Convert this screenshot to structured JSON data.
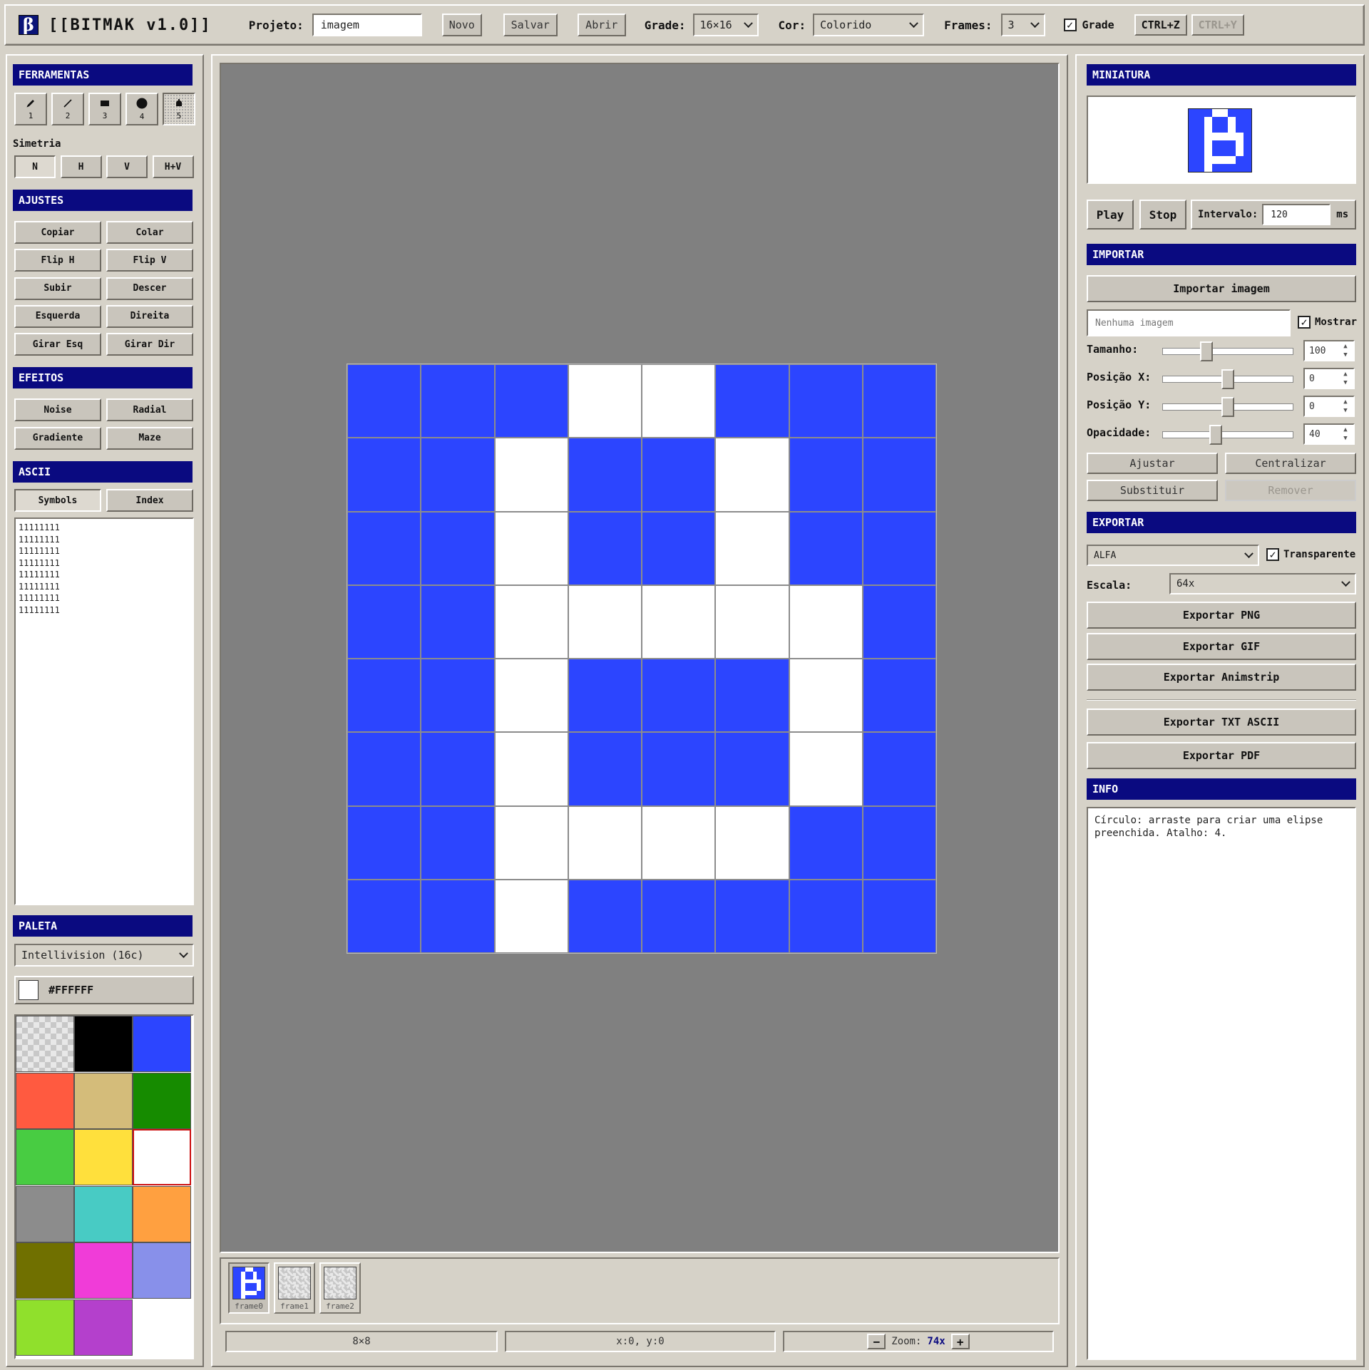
{
  "app": {
    "logo_glyph": "β",
    "title": "[[BITMAK v1.0]]"
  },
  "toolbar": {
    "project_label": "Projeto:",
    "project_value": "imagem",
    "new_label": "Novo",
    "save_label": "Salvar",
    "open_label": "Abrir",
    "grid_label": "Grade:",
    "grid_value": "16×16",
    "color_label": "Cor:",
    "color_value": "Colorido",
    "frames_label": "Frames:",
    "frames_value": "3",
    "show_grid_label": "Grade",
    "show_grid_checked": true,
    "undo_label": "CTRL+Z",
    "redo_label": "CTRL+Y"
  },
  "left": {
    "tools_title": "FERRAMENTAS",
    "tools": [
      {
        "icon": "pencil-icon",
        "key": "1"
      },
      {
        "icon": "line-icon",
        "key": "2"
      },
      {
        "icon": "rectangle-icon",
        "key": "3"
      },
      {
        "icon": "circle-icon",
        "key": "4"
      },
      {
        "icon": "bucket-fill-icon",
        "key": "5"
      }
    ],
    "active_tool_index": 4,
    "symmetry_label": "Simetria",
    "symmetry": [
      "N",
      "H",
      "V",
      "H+V"
    ],
    "symmetry_active": "N",
    "adjust_title": "AJUSTES",
    "adjust_buttons": [
      "Copiar",
      "Colar",
      "Flip H",
      "Flip V",
      "Subir",
      "Descer",
      "Esquerda",
      "Direita",
      "Girar Esq",
      "Girar Dir"
    ],
    "effects_title": "EFEITOS",
    "effects_buttons": [
      "Noise",
      "Radial",
      "Gradiente",
      "Maze"
    ],
    "ascii_title": "ASCII",
    "ascii_modes": [
      "Symbols",
      "Index"
    ],
    "ascii_active": "Symbols",
    "ascii_text": "11111111\n11111111\n11111111\n11111111\n11111111\n11111111\n11111111\n11111111",
    "palette_title": "PALETA",
    "palette_name": "Intellivision (16c)",
    "current_color": "#FFFFFF",
    "palette": [
      "transparent",
      "#000000",
      "#2c45ff",
      "#ff5a40",
      "#d4bc7a",
      "#168b00",
      "#48cc42",
      "#ffe03c",
      "#ffffff",
      "#8c8c8c",
      "#48cbc4",
      "#ffa040",
      "#707000",
      "#f03cd8",
      "#8890ea",
      "#90e02c",
      "#b440cc"
    ],
    "selected_palette_index": 8
  },
  "canvas": {
    "cells": [
      "BBBWWBBB",
      "BBWBBWBB",
      "BBWBBWBB",
      "BBWWWWWB",
      "BBWBBBWB",
      "BBWBBBWB",
      "BBWWWWBB",
      "BBWBBBBB"
    ],
    "colors": {
      "B": "#2c45ff",
      "W": "#ffffff"
    },
    "background": "#808080"
  },
  "frames": [
    {
      "label": "frame0",
      "has_content": true
    },
    {
      "label": "frame1",
      "has_content": false
    },
    {
      "label": "frame2",
      "has_content": false
    }
  ],
  "status": {
    "size": "8×8",
    "coords": "x:0, y:0",
    "zoom_label": "Zoom:",
    "zoom_value": "74x",
    "zoom_out": "−",
    "zoom_in": "+"
  },
  "right": {
    "preview_title": "MINIATURA",
    "play_label": "Play",
    "stop_label": "Stop",
    "interval_label": "Intervalo:",
    "interval_value": "120",
    "interval_unit": "ms",
    "import_title": "IMPORTAR",
    "import_button": "Importar imagem",
    "import_file_placeholder": "Nenhuma imagem",
    "show_label": "Mostrar",
    "show_checked": true,
    "size_label": "Tamanho:",
    "size_value": "100",
    "size_level": 0.32,
    "posx_label": "Posição X:",
    "posx_value": "0",
    "posx_level": 0.5,
    "posy_label": "Posição Y:",
    "posy_value": "0",
    "posy_level": 0.5,
    "opacity_label": "Opacidade:",
    "opacity_value": "40",
    "opacity_level": 0.4,
    "fit_button": "Ajustar",
    "center_button": "Centralizar",
    "replace_button": "Substituir",
    "remove_button": "Remover",
    "export_title": "EXPORTAR",
    "export_mode": "ALFA",
    "transparent_label": "Transparente",
    "transparent_checked": true,
    "scale_label": "Escala:",
    "scale_value": "64x",
    "export_png": "Exportar PNG",
    "export_gif": "Exportar GIF",
    "export_animstrip": "Exportar Animstrip",
    "export_txt": "Exportar TXT ASCII",
    "export_pdf": "Exportar PDF",
    "info_title": "INFO",
    "info_text": "Círculo: arraste para criar uma elipse\npreenchida. Atalho: 4."
  }
}
